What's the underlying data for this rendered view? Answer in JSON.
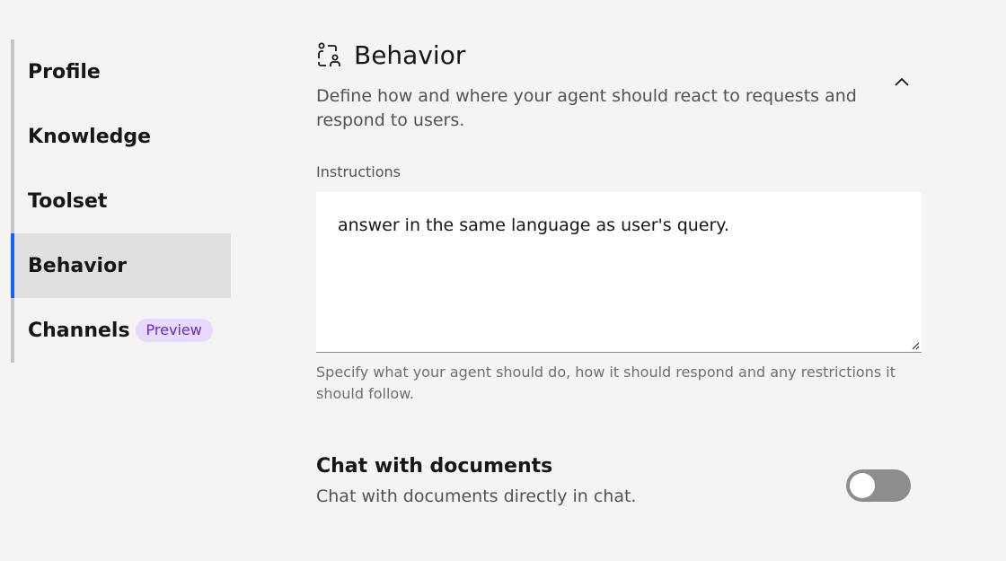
{
  "sidebar": {
    "items": [
      {
        "label": "Profile"
      },
      {
        "label": "Knowledge"
      },
      {
        "label": "Toolset"
      },
      {
        "label": "Behavior",
        "active": true
      },
      {
        "label": "Channels",
        "tag": "Preview"
      }
    ]
  },
  "section": {
    "icon": "behavior-person-icon",
    "title": "Behavior",
    "description": "Define how and where your agent should react to requests and respond to users.",
    "collapse_icon": "chevron-up-icon"
  },
  "instructions": {
    "label": "Instructions",
    "value": "answer in the same language as user's query.",
    "helper": "Specify what your agent should do, how it should respond and any restrictions it should follow."
  },
  "chat_with_documents": {
    "title": "Chat with documents",
    "description": "Chat with documents directly in chat.",
    "toggle_on": false
  },
  "colors": {
    "accent": "#0f62fe",
    "tag_bg": "#e8daff",
    "tag_text": "#6929c4",
    "toggle_off": "#8d8d8d"
  }
}
